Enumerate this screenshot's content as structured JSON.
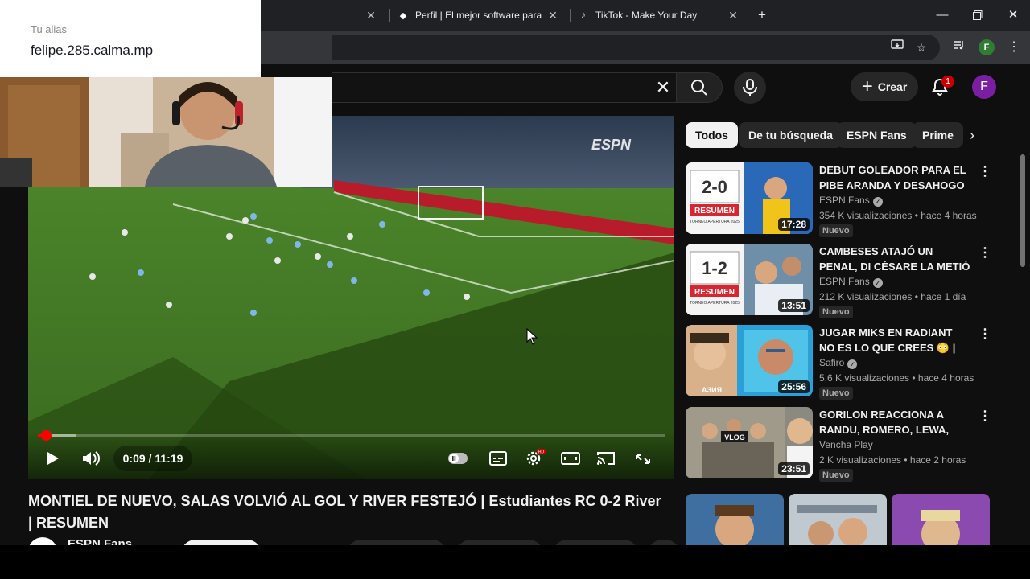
{
  "browser": {
    "tabs": [
      {
        "title": "",
        "favicon_icon": "",
        "partial": true
      },
      {
        "title": "Perfil | El mejor software para p",
        "favicon_icon": "diamond-icon"
      },
      {
        "title": "TikTok - Make Your Day",
        "favicon_icon": "tiktok-icon"
      }
    ],
    "profile_letter": "F"
  },
  "overlay": {
    "alias_label": "Tu alias",
    "alias_value": "felipe.285.calma.mp"
  },
  "youtube": {
    "create_label": "Crear",
    "notifications_count": "1",
    "avatar_letter": "F",
    "player": {
      "current_time": "0:09",
      "duration": "11:19",
      "time_display": "0:09 / 11:19",
      "played_fraction": 0.013,
      "buffered_fraction": 0.06,
      "broadcaster_watermark": "ESPN"
    },
    "video_title": "MONTIEL DE NUEVO, SALAS VOLVIÓ AL GOL Y RIVER FESTEJÓ | Estudiantes RC 0-2 River | RESUMEN",
    "channel_name": "ESPN Fans",
    "chips": [
      "Todos",
      "De tu búsqueda",
      "ESPN Fans",
      "Prime"
    ],
    "recommendations": [
      {
        "title": "DEBUT GOLEADOR PARA EL PIBE ARANDA Y DESAHOGO ...",
        "channel": "ESPN Fans",
        "verified": true,
        "meta": "354 K visualizaciones • hace 4 horas",
        "badge": "Nuevo",
        "duration": "17:28",
        "thumb_score": "2-0",
        "thumb_label": "RESUMEN",
        "thumb_sub": "TORNEO APERTURA 2025"
      },
      {
        "title": "CAMBESES ATAJÓ UN PENAL, DI CÉSARE LA METIÓ Y LA ...",
        "channel": "ESPN Fans",
        "verified": true,
        "meta": "212 K visualizaciones • hace 1 día",
        "badge": "Nuevo",
        "duration": "13:51",
        "thumb_score": "1-2",
        "thumb_label": "RESUMEN",
        "thumb_sub": "TORNEO APERTURA 2025"
      },
      {
        "title": "JUGAR MIKS EN RADIANT NO ES LO QUE CREES 😳 | Safiro",
        "channel": "Safiro",
        "verified": true,
        "meta": "5,6 K visualizaciones • hace 4 horas",
        "badge": "Nuevo",
        "duration": "25:56",
        "thumb_label": "АЗИЯ"
      },
      {
        "title": "GORILON REACCIONA A RANDU, ROMERO, LEWA, STE...",
        "channel": "Vencha Play",
        "verified": false,
        "meta": "2 K visualizaciones • hace 2 horas",
        "badge": "Nuevo",
        "duration": "23:51",
        "thumb_label": "VLOG"
      }
    ]
  },
  "colors": {
    "yt_bg": "#0f0f0f",
    "chrome_tabbar": "#202124",
    "chrome_toolbar": "#35363a",
    "progress_red": "#ff0000",
    "pitch_green": "#3d6b22"
  }
}
